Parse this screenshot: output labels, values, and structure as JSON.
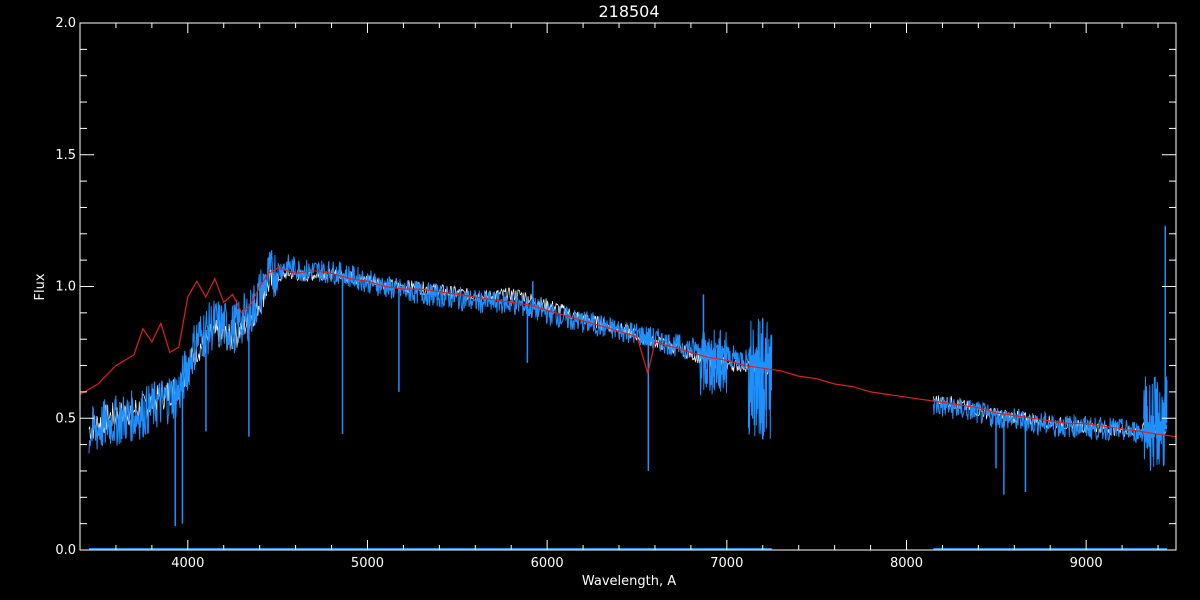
{
  "chart_data": {
    "type": "line",
    "title": "218504",
    "xlabel": "Wavelength, A",
    "ylabel": "Flux",
    "xlim": [
      3400,
      9500
    ],
    "ylim": [
      0.0,
      2.0
    ],
    "x_ticks": [
      4000,
      5000,
      6000,
      7000,
      8000,
      9000
    ],
    "x_tick_labels": [
      "4000",
      "5000",
      "6000",
      "7000",
      "8000",
      "9000"
    ],
    "y_ticks": [
      0.0,
      0.5,
      1.0,
      1.5,
      2.0
    ],
    "y_tick_labels": [
      "0.0",
      "0.5",
      "1.0",
      "1.5",
      "2.0"
    ],
    "grid": false,
    "background": "#000000",
    "axis_color": "#ffffff",
    "series": [
      {
        "color": "#ffffff",
        "segments": [
          {
            "x": [
              3450,
              3550,
              3650,
              3750,
              3850,
              3950,
              4050,
              4150,
              4250,
              4350,
              4450,
              4550,
              4650,
              4750,
              4850,
              4950,
              5050,
              5150,
              5250,
              5350,
              5450,
              5550,
              5650,
              5750,
              5850,
              5950,
              6050,
              6150,
              6250,
              6350,
              6450,
              6550,
              6650,
              6750,
              6850,
              6950,
              7050,
              7150,
              7250
            ],
            "y": [
              0.46,
              0.5,
              0.52,
              0.54,
              0.58,
              0.62,
              0.76,
              0.82,
              0.8,
              0.88,
              1.01,
              1.05,
              1.04,
              1.05,
              1.04,
              1.03,
              1.02,
              1.0,
              1.0,
              0.99,
              0.98,
              0.97,
              0.96,
              0.97,
              0.97,
              0.94,
              0.92,
              0.89,
              0.87,
              0.85,
              0.83,
              0.8,
              0.78,
              0.76,
              0.73,
              0.71,
              0.7,
              0.7,
              0.68
            ]
          },
          {
            "x": [
              8150,
              8250,
              8350,
              8450,
              8550,
              8650,
              8750,
              8850,
              8950,
              9050,
              9150,
              9250,
              9350,
              9450
            ],
            "y": [
              0.57,
              0.56,
              0.54,
              0.52,
              0.51,
              0.5,
              0.49,
              0.48,
              0.47,
              0.47,
              0.46,
              0.45,
              0.46,
              0.46
            ]
          }
        ]
      },
      {
        "color": "#1e90ff",
        "segments": [
          {
            "x": [
              3450,
              3550,
              3650,
              3750,
              3850,
              3950,
              4050,
              4150,
              4250,
              4350,
              4450,
              4550,
              4650,
              4750,
              4850,
              4950,
              5050,
              5150,
              5250,
              5350,
              5450,
              5550,
              5650,
              5750,
              5850,
              5950,
              6050,
              6150,
              6250,
              6350,
              6450,
              6550,
              6650,
              6750,
              6850,
              6950,
              7050,
              7150,
              7250
            ],
            "y": [
              0.44,
              0.48,
              0.5,
              0.52,
              0.56,
              0.6,
              0.8,
              0.86,
              0.84,
              0.9,
              1.04,
              1.08,
              1.06,
              1.06,
              1.05,
              1.03,
              1.01,
              0.99,
              0.98,
              0.97,
              0.96,
              0.95,
              0.94,
              0.94,
              0.93,
              0.91,
              0.89,
              0.87,
              0.86,
              0.84,
              0.83,
              0.81,
              0.79,
              0.77,
              0.76,
              0.74,
              0.73,
              0.72,
              0.7
            ]
          },
          {
            "x": [
              8150,
              8250,
              8350,
              8450,
              8550,
              8650,
              8750,
              8850,
              8950,
              9050,
              9150,
              9250,
              9350,
              9450
            ],
            "y": [
              0.55,
              0.54,
              0.53,
              0.51,
              0.5,
              0.49,
              0.48,
              0.47,
              0.47,
              0.46,
              0.46,
              0.45,
              0.45,
              0.46
            ]
          }
        ],
        "dips": [
          {
            "x": 3930,
            "y": 0.09
          },
          {
            "x": 3970,
            "y": 0.1
          },
          {
            "x": 4101,
            "y": 0.45
          },
          {
            "x": 4340,
            "y": 0.43
          },
          {
            "x": 4861,
            "y": 0.44
          },
          {
            "x": 5175,
            "y": 0.6
          },
          {
            "x": 5890,
            "y": 0.71
          },
          {
            "x": 6563,
            "y": 0.3
          },
          {
            "x": 7200,
            "y": 0.42
          },
          {
            "x": 8498,
            "y": 0.31
          },
          {
            "x": 8542,
            "y": 0.21
          },
          {
            "x": 8662,
            "y": 0.22
          }
        ],
        "spikes": [
          {
            "x": 5920,
            "y": 1.02
          },
          {
            "x": 6870,
            "y": 0.97
          },
          {
            "x": 7200,
            "y": 0.88
          },
          {
            "x": 9440,
            "y": 1.23
          }
        ],
        "noise_bands": [
          {
            "x": [
              6850,
              7000
            ],
            "y": [
              0.58,
              0.84
            ]
          },
          {
            "x": [
              7120,
              7250
            ],
            "y": [
              0.42,
              0.88
            ]
          },
          {
            "x": [
              9320,
              9450
            ],
            "y": [
              0.3,
              0.66
            ]
          }
        ],
        "baseline_segments": [
          {
            "x": [
              3450,
              7250
            ],
            "y": 0.0
          },
          {
            "x": [
              8150,
              9450
            ],
            "y": 0.0
          }
        ]
      },
      {
        "color": "#e02020",
        "segments": [
          {
            "x": [
              3400,
              3500,
              3600,
              3700,
              3750,
              3800,
              3850,
              3900,
              3950,
              4000,
              4050,
              4100,
              4150,
              4200,
              4250,
              4300,
              4350,
              4400,
              4450,
              4500,
              4600,
              4700,
              4800,
              4900,
              5000,
              5100,
              5200,
              5300,
              5400,
              5500,
              5600,
              5700,
              5800,
              5900,
              6000,
              6100,
              6200,
              6300,
              6400,
              6500,
              6560,
              6600,
              6700,
              6800,
              6900,
              7000,
              7100,
              7200,
              7300,
              7400,
              7500,
              7600,
              7700,
              7800,
              7900,
              8000,
              8100,
              8200,
              8300,
              8400,
              8500,
              8600,
              8700,
              8800,
              8900,
              9000,
              9100,
              9200,
              9300,
              9400,
              9500
            ],
            "y": [
              0.59,
              0.63,
              0.7,
              0.74,
              0.84,
              0.79,
              0.86,
              0.75,
              0.77,
              0.96,
              1.02,
              0.96,
              1.03,
              0.94,
              0.97,
              0.9,
              0.93,
              1.0,
              1.05,
              1.07,
              1.05,
              1.06,
              1.05,
              1.03,
              1.02,
              1.0,
              0.99,
              0.99,
              0.98,
              0.97,
              0.96,
              0.95,
              0.94,
              0.93,
              0.91,
              0.89,
              0.87,
              0.85,
              0.83,
              0.81,
              0.67,
              0.79,
              0.77,
              0.75,
              0.73,
              0.72,
              0.7,
              0.69,
              0.68,
              0.66,
              0.65,
              0.63,
              0.62,
              0.6,
              0.59,
              0.58,
              0.57,
              0.56,
              0.55,
              0.54,
              0.52,
              0.51,
              0.5,
              0.49,
              0.48,
              0.48,
              0.47,
              0.46,
              0.45,
              0.44,
              0.43
            ]
          }
        ]
      }
    ]
  }
}
